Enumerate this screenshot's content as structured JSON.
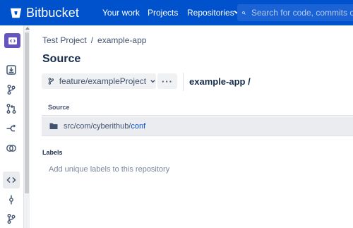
{
  "colors": {
    "brand": "#0052cc",
    "sidebar_accent": "#6554c0",
    "row_bg": "#ebecf0"
  },
  "header": {
    "app_name": "Bitbucket",
    "nav": [
      "Your work",
      "Projects",
      "Repositories"
    ],
    "search_placeholder": "Search for code, commits or"
  },
  "sidebar": {
    "icons": [
      "repo-avatar-icon",
      "clone-icon",
      "branches-icon",
      "pull-requests-icon",
      "forks-icon",
      "compare-icon",
      "source-icon",
      "commits-icon",
      "branch-icon"
    ],
    "active": "source-icon"
  },
  "breadcrumb": {
    "project": "Test Project",
    "separator": "/",
    "repo": "example-app"
  },
  "page": {
    "title": "Source"
  },
  "branch": {
    "name": "feature/exampleProject",
    "more_label": "···"
  },
  "repo_path": "example-app /",
  "table": {
    "header": "Source",
    "rows": [
      {
        "path_prefix": "src/com/cyberithub/",
        "path_link": "conf"
      }
    ]
  },
  "labels": {
    "header": "Labels",
    "placeholder": "Add unique labels to this repository"
  }
}
